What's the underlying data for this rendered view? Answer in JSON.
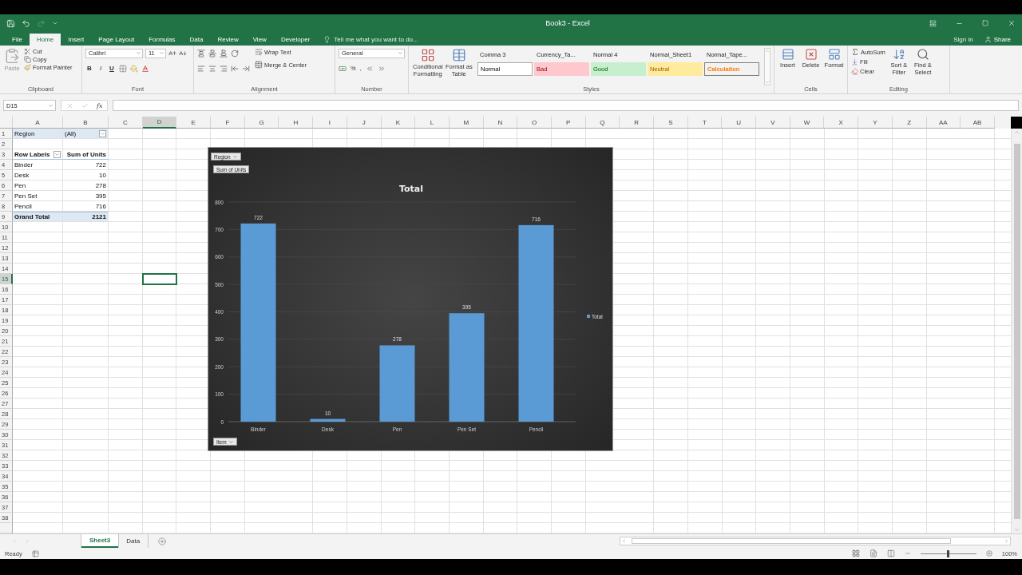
{
  "window": {
    "title": "Book3 - Excel"
  },
  "menu_tabs": [
    {
      "label": "File",
      "selected": false
    },
    {
      "label": "Home",
      "selected": true
    },
    {
      "label": "Insert",
      "selected": false
    },
    {
      "label": "Page Layout",
      "selected": false
    },
    {
      "label": "Formulas",
      "selected": false
    },
    {
      "label": "Data",
      "selected": false
    },
    {
      "label": "Review",
      "selected": false
    },
    {
      "label": "View",
      "selected": false
    },
    {
      "label": "Developer",
      "selected": false
    }
  ],
  "tell_me": {
    "placeholder": "Tell me what you want to do..."
  },
  "account": {
    "sign_in": "Sign in",
    "share": "Share"
  },
  "ribbon": {
    "clipboard": {
      "label": "Clipboard",
      "paste": "Paste",
      "cut": "Cut",
      "copy": "Copy",
      "format_painter": "Format Painter"
    },
    "font": {
      "label": "Font",
      "name": "Calibri",
      "size": "11",
      "bold": "B",
      "italic": "I",
      "underline": "U"
    },
    "alignment": {
      "label": "Alignment",
      "wrap": "Wrap Text",
      "merge": "Merge & Center"
    },
    "number": {
      "label": "Number",
      "format": "General",
      "percent": "%",
      "comma": ","
    },
    "styles": {
      "label": "Styles",
      "conditional": "Conditional Formatting",
      "format_table": "Format as Table",
      "gallery": [
        {
          "label": "Comma 3",
          "kind": "plain"
        },
        {
          "label": "Currency_Ta...",
          "kind": "plain"
        },
        {
          "label": "Normal 4",
          "kind": "plain"
        },
        {
          "label": "Normal_Sheet1",
          "kind": "plain"
        },
        {
          "label": "Normal_Tape...",
          "kind": "plain"
        },
        {
          "label": "Normal",
          "kind": "normal"
        },
        {
          "label": "Bad",
          "kind": "bad"
        },
        {
          "label": "Good",
          "kind": "good"
        },
        {
          "label": "Neutral",
          "kind": "neutral"
        },
        {
          "label": "Calculation",
          "kind": "calculation"
        }
      ]
    },
    "cells": {
      "label": "Cells",
      "insert": "Insert",
      "delete": "Delete",
      "format": "Format"
    },
    "editing": {
      "label": "Editing",
      "autosum": "AutoSum",
      "fill": "Fill",
      "clear": "Clear",
      "sort": "Sort & Filter",
      "find": "Find & Select"
    }
  },
  "formula_bar": {
    "name_box": "D15",
    "function_label": "fx"
  },
  "sheet": {
    "columns": [
      {
        "label": "A",
        "selected": false
      },
      {
        "label": "B",
        "selected": false
      },
      {
        "label": "C",
        "selected": false
      },
      {
        "label": "D",
        "selected": true
      },
      {
        "label": "E",
        "selected": false
      },
      {
        "label": "F",
        "selected": false
      },
      {
        "label": "G",
        "selected": false
      },
      {
        "label": "H",
        "selected": false
      },
      {
        "label": "I",
        "selected": false
      },
      {
        "label": "J",
        "selected": false
      },
      {
        "label": "K",
        "selected": false
      },
      {
        "label": "L",
        "selected": false
      },
      {
        "label": "M",
        "selected": false
      },
      {
        "label": "N",
        "selected": false
      },
      {
        "label": "O",
        "selected": false
      },
      {
        "label": "P",
        "selected": false
      },
      {
        "label": "Q",
        "selected": false
      },
      {
        "label": "R",
        "selected": false
      },
      {
        "label": "S",
        "selected": false
      },
      {
        "label": "T",
        "selected": false
      },
      {
        "label": "U",
        "selected": false
      },
      {
        "label": "V",
        "selected": false
      },
      {
        "label": "W",
        "selected": false
      },
      {
        "label": "X",
        "selected": false
      },
      {
        "label": "Y",
        "selected": false
      },
      {
        "label": "Z",
        "selected": false
      },
      {
        "label": "AA",
        "selected": false
      },
      {
        "label": "AB",
        "selected": false
      }
    ],
    "rows": [
      {
        "label": "1",
        "selected": false
      },
      {
        "label": "2",
        "selected": false
      },
      {
        "label": "3",
        "selected": false
      },
      {
        "label": "4",
        "selected": false
      },
      {
        "label": "5",
        "selected": false
      },
      {
        "label": "6",
        "selected": false
      },
      {
        "label": "7",
        "selected": false
      },
      {
        "label": "8",
        "selected": false
      },
      {
        "label": "9",
        "selected": false
      },
      {
        "label": "10",
        "selected": false
      },
      {
        "label": "11",
        "selected": false
      },
      {
        "label": "12",
        "selected": false
      },
      {
        "label": "13",
        "selected": false
      },
      {
        "label": "14",
        "selected": false
      },
      {
        "label": "15",
        "selected": true
      },
      {
        "label": "16",
        "selected": false
      },
      {
        "label": "17",
        "selected": false
      },
      {
        "label": "18",
        "selected": false
      },
      {
        "label": "19",
        "selected": false
      },
      {
        "label": "20",
        "selected": false
      },
      {
        "label": "21",
        "selected": false
      },
      {
        "label": "22",
        "selected": false
      },
      {
        "label": "23",
        "selected": false
      },
      {
        "label": "24",
        "selected": false
      },
      {
        "label": "25",
        "selected": false
      },
      {
        "label": "26",
        "selected": false
      },
      {
        "label": "27",
        "selected": false
      },
      {
        "label": "28",
        "selected": false
      },
      {
        "label": "29",
        "selected": false
      },
      {
        "label": "30",
        "selected": false
      },
      {
        "label": "31",
        "selected": false
      },
      {
        "label": "32",
        "selected": false
      },
      {
        "label": "33",
        "selected": false
      },
      {
        "label": "34",
        "selected": false
      },
      {
        "label": "35",
        "selected": false
      },
      {
        "label": "36",
        "selected": false
      },
      {
        "label": "37",
        "selected": false
      },
      {
        "label": "38",
        "selected": false
      }
    ]
  },
  "pivot": {
    "filter": {
      "label": "Region",
      "value": "(All)"
    },
    "header": {
      "labels": "Row Labels",
      "values": "Sum of Units"
    },
    "rows": [
      {
        "label": "Binder",
        "value": "722"
      },
      {
        "label": "Desk",
        "value": "10"
      },
      {
        "label": "Pen",
        "value": "278"
      },
      {
        "label": "Pen Set",
        "value": "395"
      },
      {
        "label": "Pencil",
        "value": "716"
      }
    ],
    "total": {
      "label": "Grand Total",
      "value": "2121"
    }
  },
  "pivot_chart": {
    "field_buttons": {
      "filter": "Region",
      "values": "Sum of Units",
      "axis": "Item"
    },
    "chart_data": {
      "type": "bar",
      "title": "Total",
      "categories": [
        "Binder",
        "Desk",
        "Pen",
        "Pen Set",
        "Pencil"
      ],
      "series": [
        {
          "name": "Total",
          "color": "#5b9bd5",
          "values": [
            722,
            10,
            278,
            395,
            716
          ]
        }
      ],
      "ylim": [
        0,
        800
      ],
      "grid": true,
      "yticks": [
        0,
        100,
        200,
        300,
        400,
        500,
        600,
        700,
        800
      ],
      "data_labels": true
    }
  },
  "sheet_tabs": [
    {
      "label": "Sheet3",
      "selected": true
    },
    {
      "label": "Data",
      "selected": false
    }
  ],
  "status_bar": {
    "status": "Ready",
    "zoom": "100%",
    "zoom_slider": {
      "level": 0.5
    }
  }
}
